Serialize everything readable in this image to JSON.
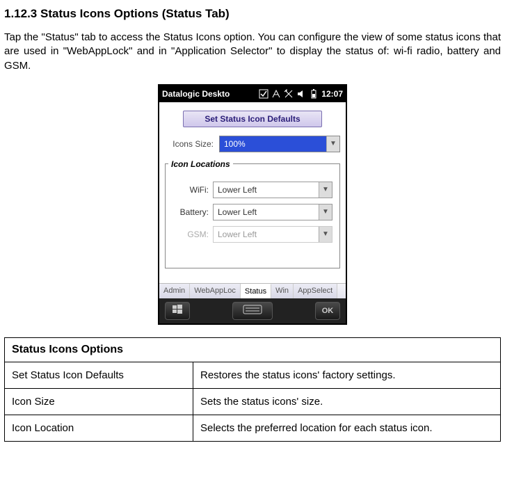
{
  "heading": "1.12.3    Status Icons Options (Status Tab)",
  "body": "Tap the \"Status\" tab to access the Status Icons option. You can configure the view of some status icons that are used in \"WebAppLock\" and in \"Application Selector\" to display the status of: wi-fi radio, battery and GSM.",
  "taskbar": {
    "title": "Datalogic Deskto",
    "clock": "12:07"
  },
  "form": {
    "setDefaultsLabel": "Set Status Icon Defaults",
    "iconsSizeLabel": "Icons Size:",
    "iconsSizeValue": "100%",
    "locationsLegend": "Icon Locations",
    "wifiLabel": "WiFi:",
    "wifiValue": "Lower Left",
    "batteryLabel": "Battery:",
    "batteryValue": "Lower Left",
    "gsmLabel": "GSM:",
    "gsmValue": "Lower Left"
  },
  "tabs": {
    "admin": "Admin",
    "webapp": "WebAppLoc",
    "status": "Status",
    "win": "Win",
    "appselect": "AppSelect"
  },
  "softbar": {
    "ok": "OK"
  },
  "table": {
    "header": "Status Icons Options",
    "rows": [
      {
        "k": "Set Status Icon Defaults",
        "v": "Restores the status icons' factory settings."
      },
      {
        "k": "Icon Size",
        "v": "Sets the status icons' size."
      },
      {
        "k": "Icon Location",
        "v": "Selects the preferred location for each status icon."
      }
    ]
  }
}
